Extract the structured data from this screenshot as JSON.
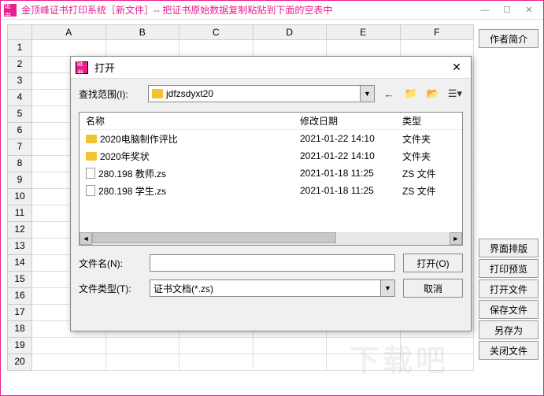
{
  "main": {
    "icon_text": "证书",
    "title": "金顶峰证书打印系统［新文件］-- 把证书原始数据复制粘贴到下面的空表中",
    "columns": [
      "A",
      "B",
      "C",
      "D",
      "E",
      "F"
    ],
    "row_count": 20
  },
  "sidebar": {
    "author": "作者简介",
    "layout": "界面排版",
    "preview": "打印预览",
    "open": "打开文件",
    "save": "保存文件",
    "saveas": "另存为",
    "close": "关闭文件"
  },
  "dialog": {
    "icon_text": "证书",
    "title": "打开",
    "lookin_label": "查找范围(I):",
    "lookin_value": "jdfzsdyxt20",
    "headers": {
      "name": "名称",
      "date": "修改日期",
      "type": "类型"
    },
    "files": [
      {
        "kind": "folder",
        "name": "2020电脑制作评比",
        "date": "2021-01-22 14:10",
        "type": "文件夹"
      },
      {
        "kind": "folder",
        "name": "2020年奖状",
        "date": "2021-01-22 14:10",
        "type": "文件夹"
      },
      {
        "kind": "file",
        "name": "280.198 教师.zs",
        "date": "2021-01-18 11:25",
        "type": "ZS 文件"
      },
      {
        "kind": "file",
        "name": "280.198 学生.zs",
        "date": "2021-01-18 11:25",
        "type": "ZS 文件"
      }
    ],
    "filename_label": "文件名(N):",
    "filename_value": "",
    "filetype_label": "文件类型(T):",
    "filetype_value": "证书文档(*.zs)",
    "open_btn": "打开(O)",
    "cancel_btn": "取消"
  },
  "watermark": "下载吧"
}
